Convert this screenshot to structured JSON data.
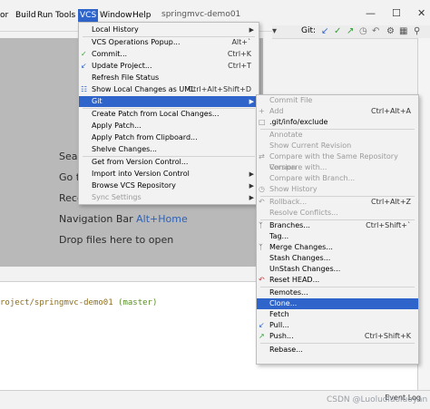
{
  "menubar": {
    "items": [
      "or",
      "Build",
      "Run",
      "Tools",
      "VCS",
      "Window",
      "Help"
    ],
    "title": "springmvc-demo01",
    "window_controls": [
      "minimize-icon",
      "maximize-icon",
      "close-icon"
    ]
  },
  "toolbar": {
    "git_label": "Git:"
  },
  "editor_hints": [
    {
      "text": "Sear"
    },
    {
      "text": "Go t"
    },
    {
      "text": "Rece"
    },
    {
      "text": "Navigation Bar",
      "key": "Alt+Home"
    },
    {
      "text": "Drop files here to open"
    }
  ],
  "vcs_menu": {
    "items": [
      {
        "label": "Local History",
        "arrow": true
      },
      {
        "label": "VCS Operations Popup...",
        "shortcut": "Alt+`"
      },
      {
        "label": "Commit...",
        "shortcut": "Ctrl+K",
        "icon": "check-icon"
      },
      {
        "label": "Update Project...",
        "shortcut": "Ctrl+T",
        "icon": "update-arrow-icon"
      },
      {
        "label": "Refresh File Status"
      },
      {
        "label": "Show Local Changes as UML",
        "shortcut": "Ctrl+Alt+Shift+D",
        "icon": "uml-icon"
      },
      {
        "label": "Git",
        "arrow": true,
        "highlighted": true
      },
      {
        "label": "Create Patch from Local Changes..."
      },
      {
        "label": "Apply Patch..."
      },
      {
        "label": "Apply Patch from Clipboard..."
      },
      {
        "label": "Shelve Changes..."
      },
      {
        "label": "Get from Version Control..."
      },
      {
        "label": "Import into Version Control",
        "arrow": true
      },
      {
        "label": "Browse VCS Repository",
        "arrow": true
      },
      {
        "label": "Sync Settings",
        "arrow": true,
        "disabled": true
      }
    ]
  },
  "git_menu": {
    "items": [
      {
        "label": "Commit File",
        "disabled": true
      },
      {
        "label": "Add",
        "shortcut": "Ctrl+Alt+A",
        "disabled": true,
        "icon": "plus-icon"
      },
      {
        "label": ".git/info/exclude",
        "icon": "exclude-icon"
      },
      {
        "label": "Annotate",
        "disabled": true
      },
      {
        "label": "Show Current Revision",
        "disabled": true
      },
      {
        "label": "Compare with the Same Repository Version",
        "disabled": true
      },
      {
        "label": "Compare with...",
        "disabled": true
      },
      {
        "label": "Compare with Branch...",
        "disabled": true
      },
      {
        "label": "Show History",
        "disabled": true
      },
      {
        "label": "Rollback...",
        "shortcut": "Ctrl+Alt+Z",
        "disabled": true
      },
      {
        "label": "Resolve Conflicts...",
        "disabled": true
      },
      {
        "label": "Branches...",
        "shortcut": "Ctrl+Shift+`"
      },
      {
        "label": "Tag..."
      },
      {
        "label": "Merge Changes..."
      },
      {
        "label": "Stash Changes..."
      },
      {
        "label": "UnStash Changes..."
      },
      {
        "label": "Reset HEAD..."
      },
      {
        "label": "Remotes..."
      },
      {
        "label": "Clone...",
        "highlighted": true
      },
      {
        "label": "Fetch"
      },
      {
        "label": "Pull...",
        "icon": "pull-icon"
      },
      {
        "label": "Push...",
        "shortcut": "Ctrl+Shift+K",
        "icon": "push-icon"
      },
      {
        "label": "Rebase..."
      }
    ]
  },
  "bottom": {
    "project_path": "roject/springmvc-demo01",
    "branch": "(master)"
  },
  "status": {
    "event_log": "Event Log",
    "watermark": "CSDN @Luoluoluoluoyan"
  },
  "colors": {
    "highlight": "#2f65ca",
    "editor_bg": "#b9b9b9",
    "menu_bg": "#f2f2f2",
    "key_blue": "#2e62b5"
  }
}
